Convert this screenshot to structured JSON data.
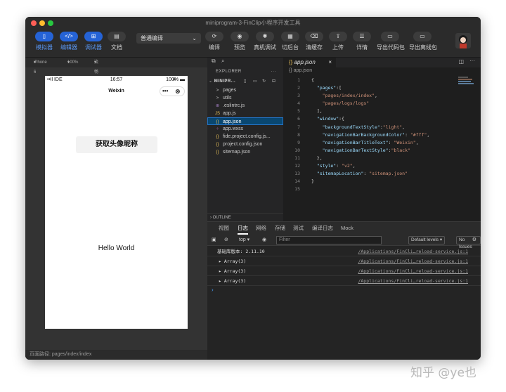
{
  "window": {
    "title": "miniprogram-3-FinClip小程序开发工具"
  },
  "toolbar": {
    "simulator": "模拟器",
    "editor": "编辑器",
    "debugger": "调试器",
    "docs": "文档",
    "compile_mode": "普通编译",
    "compile": "编译",
    "preview": "预览",
    "remote_debug": "真机调试",
    "background": "切后台",
    "clear_cache": "清缓存",
    "upload": "上传",
    "details": "详情",
    "export_package": "导出代码包",
    "export_offline": "导出离线包"
  },
  "simulator": {
    "device": "iPhone 6",
    "zoom": "100%",
    "network": "流畅",
    "status_carrier": "••ll IDE",
    "status_time": "16:57",
    "status_battery": "100%",
    "nav_title": "Weixin",
    "capsule_more": "•••",
    "capsule_close": "⊗",
    "button_label": "获取头像昵称",
    "hello": "Hello World",
    "path": "页面路径: pages/index/index"
  },
  "explorer": {
    "title": "EXPLORER",
    "more": "···",
    "project": "MINIPR...",
    "items": [
      {
        "icon": ">",
        "label": "pages",
        "indent": 1
      },
      {
        "icon": ">",
        "label": "utils",
        "indent": 1
      },
      {
        "icon": "⊛",
        "label": ".eslintrc.js",
        "indent": 1
      },
      {
        "icon": "JS",
        "label": "app.js",
        "indent": 1
      },
      {
        "icon": "{}",
        "label": "app.json",
        "indent": 1
      },
      {
        "icon": "♀",
        "label": "app.wxss",
        "indent": 1
      },
      {
        "icon": "{}",
        "label": "fide.project.config.js...",
        "indent": 1
      },
      {
        "icon": "{}",
        "label": "project.config.json",
        "indent": 1
      },
      {
        "icon": "{}",
        "label": "sitemap.json",
        "indent": 1
      }
    ],
    "outline": "OUTLINE"
  },
  "editor": {
    "tab": "app.json",
    "breadcrumb": "{} app.json",
    "lines": [
      "1",
      "2",
      "3",
      "4",
      "5",
      "6",
      "7",
      "8",
      "9",
      "10",
      "11",
      "12",
      "13",
      "14",
      "15"
    ]
  },
  "devtools": {
    "tabs": [
      "视图",
      "日志",
      "网络",
      "存储",
      "测试",
      "编译日志",
      "Mock"
    ],
    "context": "top",
    "filter_placeholder": "Filter",
    "levels": "Default levels",
    "issues": "No Issues",
    "logs": [
      {
        "msg": "基础库版本: 2.11.10",
        "src": "/Applications/FinCli…reload-service.js:1"
      },
      {
        "msg": "▸ Array(3)",
        "src": "/Applications/FinCli…reload-service.js:1"
      },
      {
        "msg": "▸ Array(3)",
        "src": "/Applications/FinCli…reload-service.js:1"
      },
      {
        "msg": "▸ Array(3)",
        "src": "/Applications/FinCli…reload-service.js:1"
      }
    ],
    "prompt": "›"
  },
  "watermark": "知乎 @ye也"
}
